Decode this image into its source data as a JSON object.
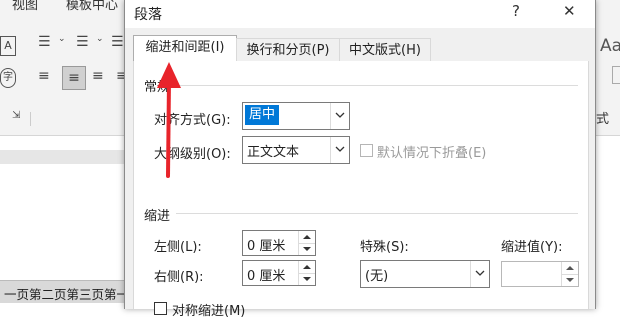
{
  "word": {
    "menu_view": "视图",
    "menu_template": "模板中心",
    "page_strip": "一页第二页第三页第一",
    "styles_preview": "Aa",
    "styles_suffix": "式"
  },
  "dialog": {
    "title": "段落",
    "help": "?",
    "close": "✕",
    "tabs": [
      "缩进和间距(I)",
      "换行和分页(P)",
      "中文版式(H)"
    ],
    "general": {
      "group": "常规",
      "alignment_label": "对齐方式(G):",
      "alignment_value": "居中",
      "outline_label": "大纲级别(O):",
      "outline_value": "正文文本",
      "collapse_label": "默认情况下折叠(E)"
    },
    "indent": {
      "group": "缩进",
      "left_label": "左侧(L):",
      "left_value": "0 厘米",
      "right_label": "右侧(R):",
      "right_value": "0 厘米",
      "special_label": "特殊(S):",
      "special_value": "(无)",
      "indent_by_label": "缩进值(Y):",
      "indent_by_value": "",
      "mirror_label": "对称缩进(M)"
    }
  },
  "annotation_color": "#e8242b"
}
